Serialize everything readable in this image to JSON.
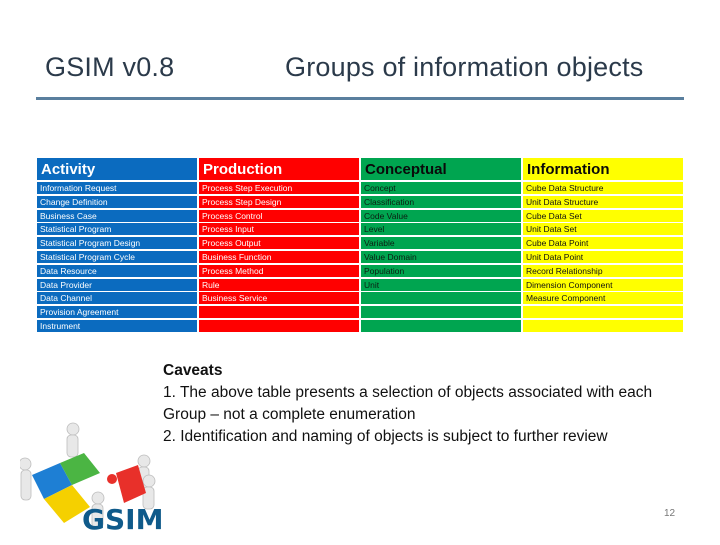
{
  "header": {
    "left_title": "GSIM v0.8",
    "right_title": "Groups of information objects",
    "rule_color": "#5a7f9e"
  },
  "table": {
    "columns": [
      {
        "name": "Activity",
        "color": "#0b6bbf",
        "items": [
          "Information Request",
          "Change Definition",
          "Business Case",
          "Statistical Program",
          "Statistical Program Design",
          "Statistical Program Cycle",
          "Data Resource",
          "Data Provider",
          "Data Channel",
          "Provision Agreement",
          "Instrument"
        ]
      },
      {
        "name": "Production",
        "color": "#ff0000",
        "items": [
          "Process Step Execution",
          "Process Step Design",
          "Process Control",
          "Process Input",
          "Process Output",
          "Business Function",
          "Process Method",
          "Rule",
          "Business Service",
          "",
          ""
        ]
      },
      {
        "name": "Conceptual",
        "color": "#00a550",
        "items": [
          "Concept",
          "Classification",
          "Code Value",
          "Level",
          "Variable",
          "Value Domain",
          "Population",
          "Unit",
          "",
          "",
          ""
        ]
      },
      {
        "name": "Information",
        "color": "#ffff00",
        "items": [
          "Cube Data Structure",
          "Unit Data Structure",
          "Cube Data Set",
          "Unit Data Set",
          "Cube Data Point",
          "Unit Data Point",
          "Record Relationship",
          "Dimension Component",
          "Measure Component",
          "",
          ""
        ]
      }
    ]
  },
  "caveats": {
    "heading": "Caveats",
    "line1": "1. The above table presents a selection of objects associated with each",
    "line2": "Group – not a complete enumeration",
    "line3": "2. Identification and naming of objects is subject to further review"
  },
  "logo": {
    "text": "GSIM",
    "icon": "puzzle-people-icon"
  },
  "page_number": "12"
}
